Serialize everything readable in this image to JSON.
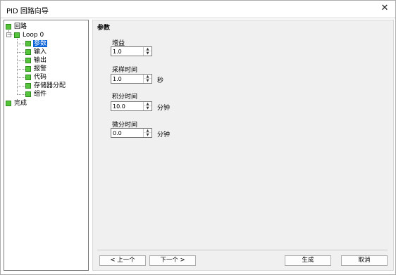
{
  "window": {
    "title": "PID 回路向导",
    "close_glyph": "✕"
  },
  "tree": {
    "root": "回路",
    "loop": "Loop 0",
    "children": [
      "参数",
      "输入",
      "输出",
      "报警",
      "代码",
      "存储器分配",
      "组件"
    ],
    "selected_index": 0,
    "finish": "完成",
    "expander": "−"
  },
  "panel": {
    "heading": "参数",
    "fields": [
      {
        "label": "增益",
        "value": "1.0",
        "unit": ""
      },
      {
        "label": "采样时间",
        "value": "1.0",
        "unit": "秒"
      },
      {
        "label": "积分时间",
        "value": "10.0",
        "unit": "分钟"
      },
      {
        "label": "微分时间",
        "value": "0.0",
        "unit": "分钟"
      }
    ]
  },
  "buttons": {
    "prev": "< 上一个",
    "next": "下一个 >",
    "generate": "生成",
    "cancel": "取消"
  },
  "icons": {
    "spin_up": "▲",
    "spin_down": "▼"
  },
  "colors": {
    "node_green": "#56c43a",
    "selection_blue": "#0a64d8"
  }
}
